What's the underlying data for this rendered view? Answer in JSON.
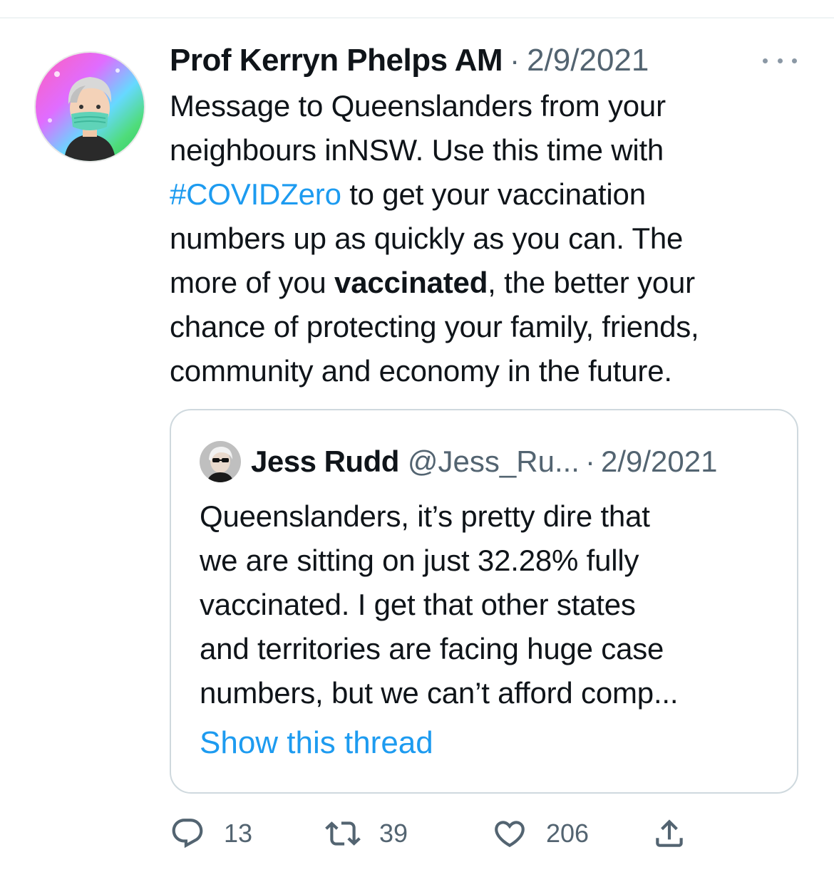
{
  "tweet": {
    "author_name": "Prof Kerryn Phelps AM",
    "separator": "·",
    "date": "2/9/2021",
    "text_lines": [
      {
        "before": "Message to Queenslanders from your"
      },
      {
        "before": "neighbours inNSW. Use this time with"
      },
      {
        "hashtag": "#COVIDZero",
        "after": " to get your vaccination"
      },
      {
        "before": "numbers up as quickly as you can. The"
      },
      {
        "before": "more of you ",
        "bold": "vaccinated",
        "after": ", the better your"
      },
      {
        "before": "chance of protecting your family, friends,"
      },
      {
        "before": "community and economy in the future."
      }
    ],
    "more_icon": "more-horizontal-icon",
    "avatar_icon": "memoji-avatar-icon"
  },
  "quote": {
    "name": "Jess Rudd",
    "handle": "@Jess_Ru...",
    "separator": "·",
    "date": "2/9/2021",
    "avatar_icon": "profile-photo-icon",
    "text_lines": [
      "Queenslanders, it’s pretty dire that",
      "we are sitting on just 32.28% fully",
      "vaccinated. I get that other states",
      "and territories are facing huge case",
      "numbers, but we can’t afford comp..."
    ],
    "show_thread": "Show this thread"
  },
  "actions": {
    "reply": {
      "icon": "reply-icon",
      "count": "13"
    },
    "retweet": {
      "icon": "retweet-icon",
      "count": "39"
    },
    "like": {
      "icon": "heart-icon",
      "count": "206"
    },
    "share": {
      "icon": "share-icon",
      "count": ""
    }
  },
  "colors": {
    "link": "#1d9bf0",
    "secondary_text": "#536471",
    "primary_text": "#0f1419",
    "border": "#cfd9de"
  }
}
